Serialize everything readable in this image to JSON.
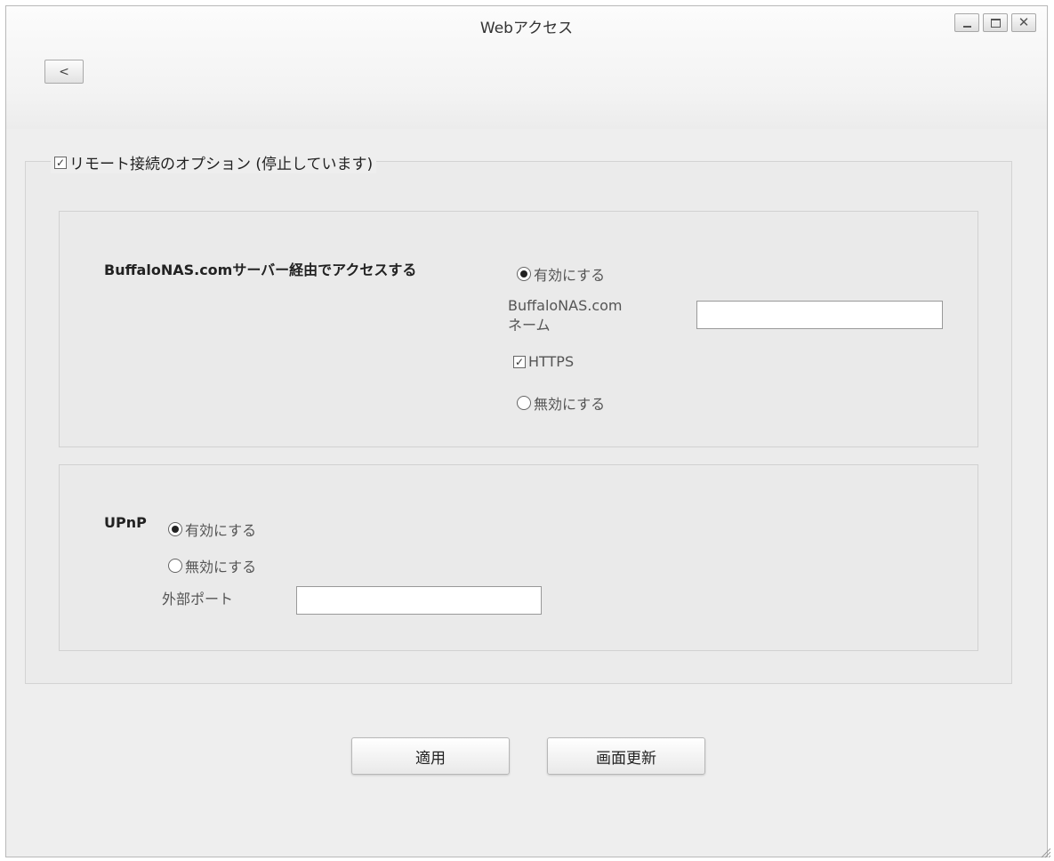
{
  "window": {
    "title": "Webアクセス",
    "close_glyph": "✕",
    "back_label": "<"
  },
  "remote": {
    "label": "リモート接続のオプション (停止しています)",
    "check_mark": "✓"
  },
  "buffalo": {
    "heading": "BuffaloNAS.comサーバー経由でアクセスする",
    "enable_label": "有効にする",
    "name_label_line1": "BuffaloNAS.com",
    "name_label_line2": "ネーム",
    "name_value": "",
    "https_label": "HTTPS",
    "disable_label": "無効にする"
  },
  "upnp": {
    "heading": "UPnP",
    "enable_label": "有効にする",
    "disable_label": "無効にする",
    "port_label": "外部ポート",
    "port_value": ""
  },
  "buttons": {
    "apply": "適用",
    "refresh": "画面更新"
  }
}
